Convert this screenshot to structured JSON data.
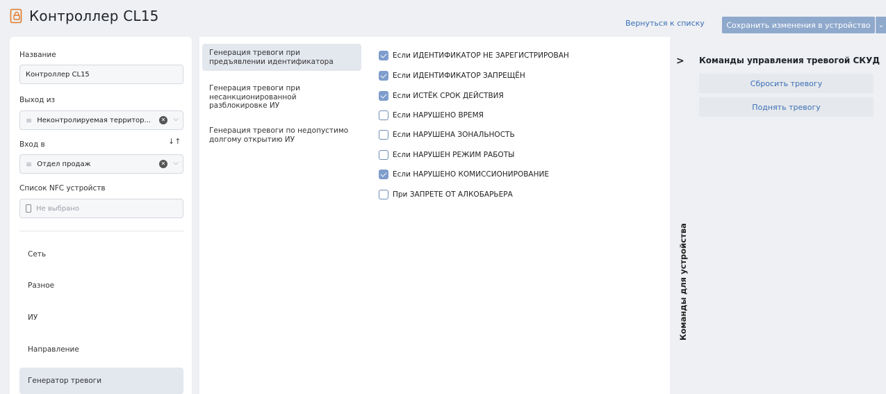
{
  "header": {
    "title": "Контроллер CL15",
    "back_link": "Вернуться к списку",
    "save_button": "Сохранить изменения в устройство"
  },
  "form": {
    "name_label": "Название",
    "name_value": "Контроллер CL15",
    "exit_label": "Выход из",
    "exit_value": "Неконтролируемая территор...",
    "entry_label": "Вход в",
    "entry_value": "Отдел продаж",
    "nfc_label": "Список NFC устройств",
    "nfc_placeholder": "Не выбрано"
  },
  "nav": {
    "items": [
      {
        "label": "Сеть"
      },
      {
        "label": "Разное"
      },
      {
        "label": "ИУ"
      },
      {
        "label": "Направление"
      },
      {
        "label": "Генератор тревоги"
      }
    ],
    "active": "Генератор тревоги"
  },
  "generation": {
    "items": [
      {
        "label": "Генерация тревоги при предъявлении идентификатора"
      },
      {
        "label": "Генерация тревоги при несанкционированной разблокировке ИУ"
      },
      {
        "label": "Генерация тревоги по недопустимо долгому открытию ИУ"
      }
    ]
  },
  "conditions": [
    {
      "label": "Если ИДЕНТИФИКАТОР НЕ ЗАРЕГИСТРИРОВАН",
      "checked": true
    },
    {
      "label": "Если ИДЕНТИФИКАТОР ЗАПРЕЩЁН",
      "checked": true
    },
    {
      "label": "Если ИСТЁК СРОК ДЕЙСТВИЯ",
      "checked": true
    },
    {
      "label": "Если НАРУШЕНО ВРЕМЯ",
      "checked": false
    },
    {
      "label": "Если НАРУШЕНА ЗОНАЛЬНОСТЬ",
      "checked": false
    },
    {
      "label": "Если НАРУШЕН РЕЖИМ РАБОТЫ",
      "checked": false
    },
    {
      "label": "Если НАРУШЕНО КОМИССИОНИРОВАНИЕ",
      "checked": true
    },
    {
      "label": "При ЗАПРЕТЕ ОТ АЛКОБАРЬЕРА",
      "checked": false
    }
  ],
  "commands": {
    "vertical_label": "Команды для устройства",
    "title": "Команды управления тревогой СКУД",
    "reset_button": "Сбросить тревогу",
    "raise_button": "Поднять тревогу"
  },
  "colors": {
    "accent": "#3a6fb7",
    "save_button_bg": "#8fa9cc",
    "checkbox_on": "#7e9ccc"
  }
}
